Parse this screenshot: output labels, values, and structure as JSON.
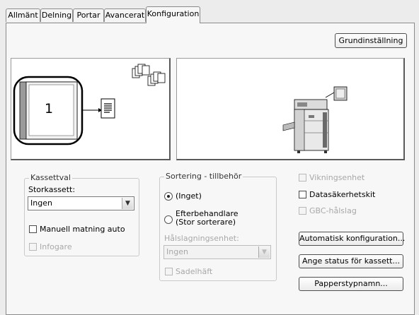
{
  "tabs": [
    {
      "label": "Allmänt"
    },
    {
      "label": "Delning"
    },
    {
      "label": "Portar"
    },
    {
      "label": "Avancerat"
    },
    {
      "label": "Konfiguration",
      "active": true
    }
  ],
  "default_button": "Grundinställning",
  "preview": {
    "tray_number": "1"
  },
  "kassettval": {
    "legend": "Kassettval",
    "storkassett_label": "Storkassett:",
    "storkassett_value": "Ingen",
    "manual_feed_label": "Manuell matning auto",
    "manual_feed_checked": false,
    "infogare_label": "Infogare",
    "infogare_enabled": false
  },
  "sortering": {
    "legend": "Sortering - tillbehör",
    "option_none": "(Inget)",
    "option_finisher_line1": "Efterbehandlare",
    "option_finisher_line2": "(Stor sorterare)",
    "selected": "none",
    "punch_label": "Hålslagningsenhet:",
    "punch_value": "Ingen",
    "saddle_label": "Sadelhäft"
  },
  "options": {
    "folding_label": "Vikningsenhet",
    "folding_enabled": false,
    "security_label": "Datasäkerhetskit",
    "security_checked": false,
    "gbc_label": "GBC-hålslag",
    "gbc_enabled": false
  },
  "buttons": {
    "auto_config": "Automatisk konfiguration...",
    "tray_status": "Ange status för kassett...",
    "paper_type": "Papperstypnamn..."
  },
  "colors": {
    "window_bg": "#ececec",
    "panel_bg": "#f7f7f7",
    "disabled_text": "#a8a8a8"
  }
}
